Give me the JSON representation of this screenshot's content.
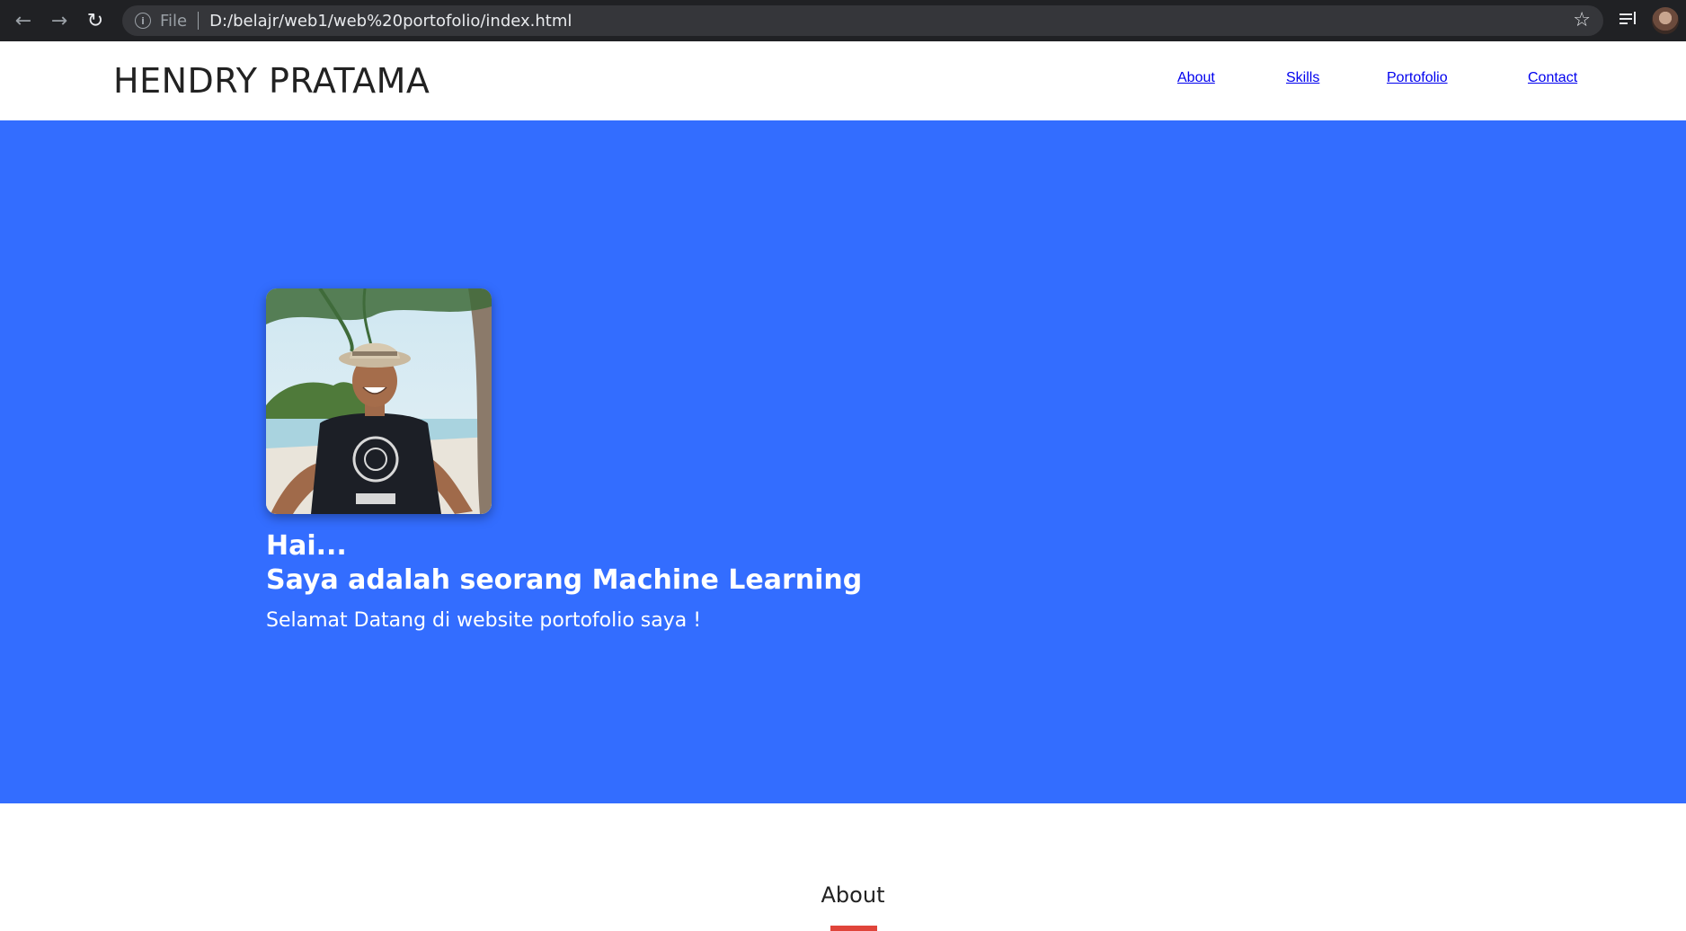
{
  "browser": {
    "scheme_label": "File",
    "url": "D:/belajr/web1/web%20portofolio/index.html",
    "icons": [
      "back-arrow-icon",
      "forward-arrow-icon",
      "reload-icon",
      "info-icon",
      "star-icon",
      "media-control-icon",
      "profile-avatar"
    ]
  },
  "header": {
    "brand": "HENDRY PRATAMA",
    "nav": [
      {
        "label": "About"
      },
      {
        "label": "Skills"
      },
      {
        "label": "Portofolio"
      },
      {
        "label": "Contact"
      }
    ]
  },
  "hero": {
    "greeting": "Hai...",
    "title": "Saya adalah seorang Machine Learning",
    "subtitle": "Selamat Datang di website portofolio saya !",
    "background_color": "#336dff"
  },
  "about": {
    "heading": "About",
    "accent_color": "#e0443a"
  }
}
